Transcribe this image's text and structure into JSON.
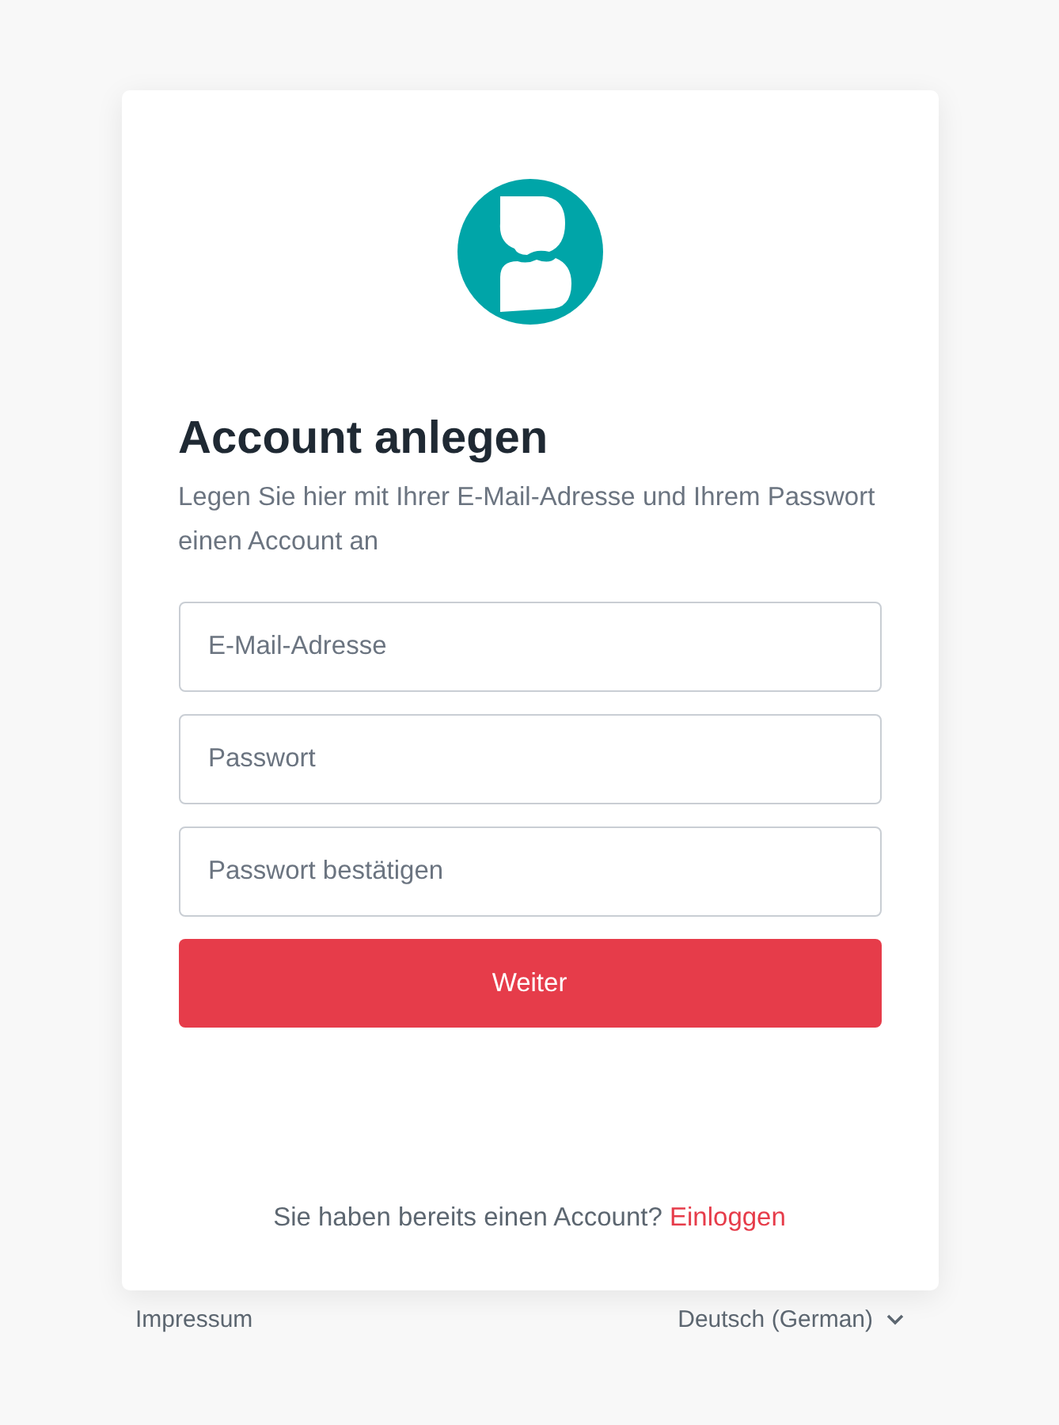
{
  "title": "Account anlegen",
  "subtitle": "Legen Sie hier mit Ihrer E-Mail-Adresse und Ihrem Passwort einen Account an",
  "fields": [
    {
      "placeholder": "E-Mail-Adresse"
    },
    {
      "placeholder": "Passwort"
    },
    {
      "placeholder": "Passwort bestätigen"
    }
  ],
  "submit": "Weiter",
  "login_prompt": {
    "text": "Sie haben bereits einen Account?",
    "link": "Einloggen"
  },
  "footer": {
    "imprint": "Impressum",
    "language": "Deutsch (German)"
  }
}
